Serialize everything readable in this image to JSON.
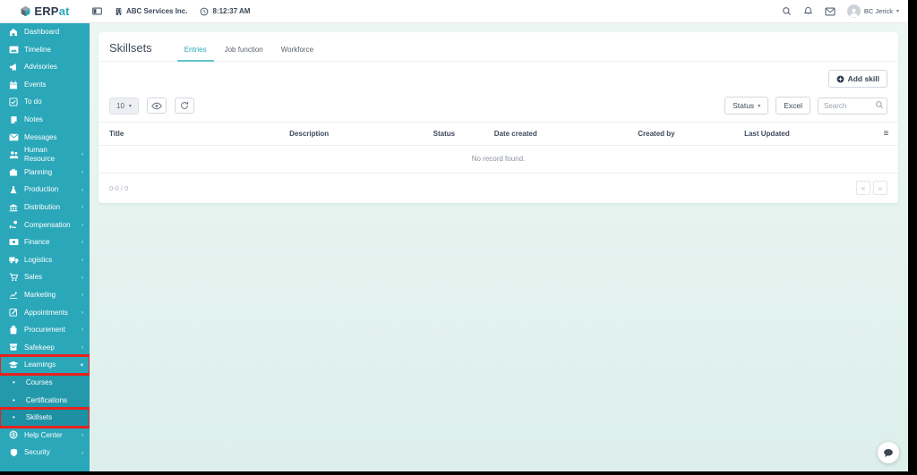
{
  "colors": {
    "accent": "#2aa7b9",
    "annotation": "#e8211d",
    "sidebar": "#2aa7b9"
  },
  "topbar": {
    "logo_primary": "ERP",
    "logo_accent": "at",
    "company": "ABC Services Inc.",
    "time": "8:12:37 AM",
    "user": "BC Jerick"
  },
  "sidebar": {
    "items": [
      {
        "label": "Dashboard",
        "icon": "dashboard-icon"
      },
      {
        "label": "Timeline",
        "icon": "timeline-icon"
      },
      {
        "label": "Advisories",
        "icon": "advisories-icon"
      },
      {
        "label": "Events",
        "icon": "events-icon"
      },
      {
        "label": "To do",
        "icon": "todo-icon"
      },
      {
        "label": "Notes",
        "icon": "notes-icon"
      },
      {
        "label": "Messages",
        "icon": "messages-icon"
      },
      {
        "label": "Human Resource",
        "icon": "human-resource-icon",
        "chevron": "right"
      },
      {
        "label": "Planning",
        "icon": "planning-icon",
        "chevron": "right"
      },
      {
        "label": "Production",
        "icon": "production-icon",
        "chevron": "right"
      },
      {
        "label": "Distribution",
        "icon": "distribution-icon",
        "chevron": "right"
      },
      {
        "label": "Compensation",
        "icon": "compensation-icon",
        "chevron": "right"
      },
      {
        "label": "Finance",
        "icon": "finance-icon",
        "chevron": "right"
      },
      {
        "label": "Logistics",
        "icon": "logistics-icon",
        "chevron": "right"
      },
      {
        "label": "Sales",
        "icon": "sales-icon",
        "chevron": "right"
      },
      {
        "label": "Marketing",
        "icon": "marketing-icon",
        "chevron": "right"
      },
      {
        "label": "Appointments",
        "icon": "appointments-icon",
        "chevron": "right"
      },
      {
        "label": "Procurement",
        "icon": "procurement-icon",
        "chevron": "right"
      },
      {
        "label": "Safekeep",
        "icon": "safekeep-icon",
        "chevron": "right"
      },
      {
        "label": "Learnings",
        "icon": "learnings-icon",
        "chevron": "down",
        "annotated": true
      },
      {
        "label": "Courses",
        "sub": true
      },
      {
        "label": "Certifications",
        "sub": true
      },
      {
        "label": "Skillsets",
        "sub": true,
        "active": true,
        "annotated": true
      },
      {
        "label": "Help Center",
        "icon": "help-center-icon",
        "chevron": "right"
      },
      {
        "label": "Security",
        "icon": "security-icon",
        "chevron": "right"
      }
    ]
  },
  "page": {
    "title": "Skillsets",
    "tabs": [
      "Entries",
      "Job function",
      "Workforce"
    ],
    "active_tab_index": 0
  },
  "toolbar": {
    "add_skill_label": "Add skill",
    "page_size": "10",
    "status_label": "Status",
    "excel_label": "Excel",
    "search_placeholder": "Search"
  },
  "table": {
    "columns": [
      "Title",
      "Description",
      "Status",
      "Date created",
      "Created by",
      "Last Updated"
    ],
    "menu_glyph": "≡",
    "empty_message": "No record found.",
    "pagination_info": "0-0 / 0",
    "prev_glyph": "«",
    "next_glyph": "»"
  }
}
